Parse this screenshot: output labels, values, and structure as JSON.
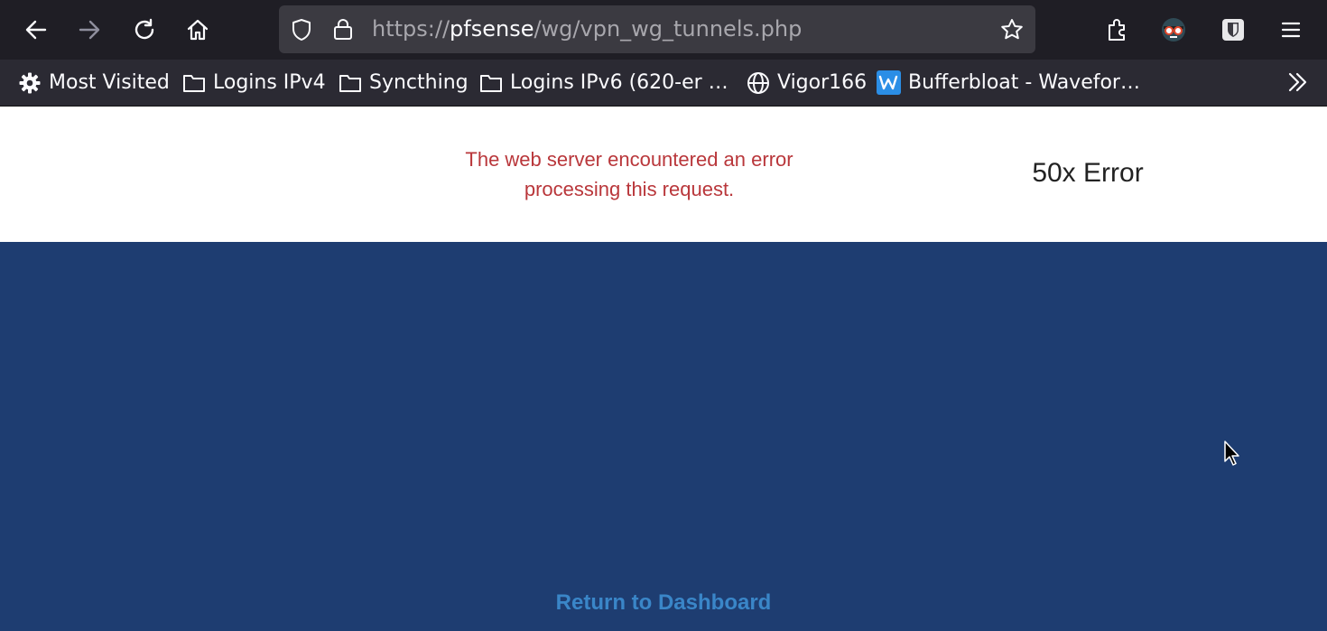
{
  "browser": {
    "url_scheme": "https://",
    "url_host": "pfsense",
    "url_path": "/wg/vpn_wg_tunnels.php"
  },
  "bookmarks": {
    "items": [
      {
        "label": "Most Visited",
        "icon": "gear-icon"
      },
      {
        "label": "Logins IPv4",
        "icon": "folder-icon"
      },
      {
        "label": "Syncthing",
        "icon": "folder-icon"
      },
      {
        "label": "Logins IPv6 (620-er …",
        "icon": "folder-icon"
      },
      {
        "label": "Vigor166",
        "icon": "globe-icon"
      },
      {
        "label": "Bufferbloat - Wavefor…",
        "icon": "waveform-icon"
      }
    ]
  },
  "page": {
    "error_message": "The web server encountered an error processing this request.",
    "error_title": "50x Error",
    "return_link": "Return to Dashboard"
  },
  "colors": {
    "toolbar_bg": "#1f1e25",
    "bookmarks_bg": "#2b2a33",
    "error_red": "#b9373b",
    "page_blue": "#1e3d71",
    "link_blue": "#3a86c8"
  }
}
